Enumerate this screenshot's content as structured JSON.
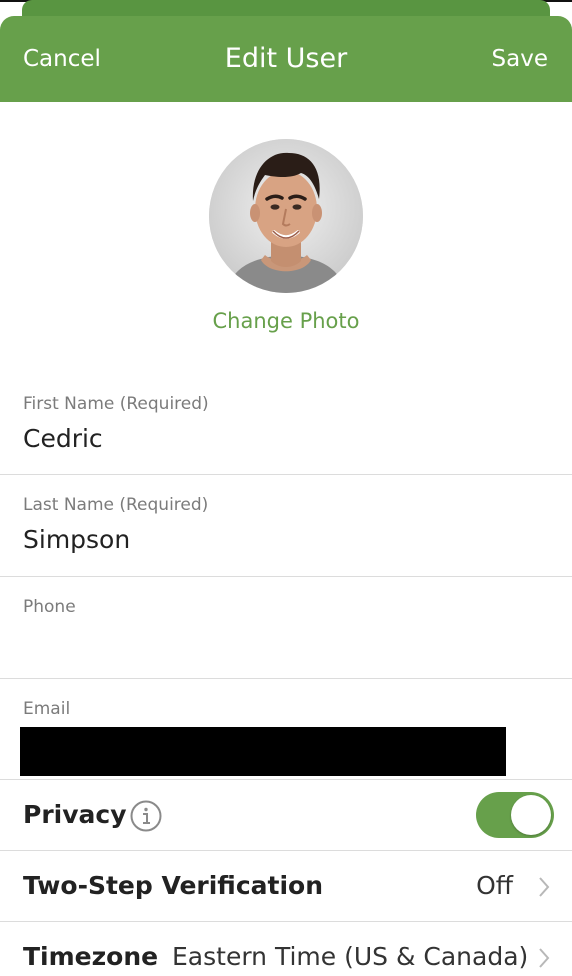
{
  "navbar": {
    "cancel_label": "Cancel",
    "title": "Edit User",
    "save_label": "Save"
  },
  "profile": {
    "change_photo_label": "Change Photo"
  },
  "fields": {
    "first_name": {
      "label": "First Name (Required)",
      "value": "Cedric"
    },
    "last_name": {
      "label": "Last Name (Required)",
      "value": "Simpson"
    },
    "phone": {
      "label": "Phone",
      "value": ""
    },
    "email": {
      "label": "Email",
      "value": ""
    }
  },
  "settings": {
    "privacy": {
      "label": "Privacy",
      "enabled": true
    },
    "two_step": {
      "label": "Two-Step Verification",
      "value": "Off"
    },
    "timezone": {
      "label": "Timezone",
      "value": "Eastern Time (US & Canada)"
    }
  },
  "colors": {
    "accent": "#67a04b",
    "text": "#222222",
    "label": "#7b7b7b",
    "divider": "#dcdcdc"
  },
  "icons": {
    "info": "info-circle-icon",
    "chevron": "chevron-right-icon"
  }
}
